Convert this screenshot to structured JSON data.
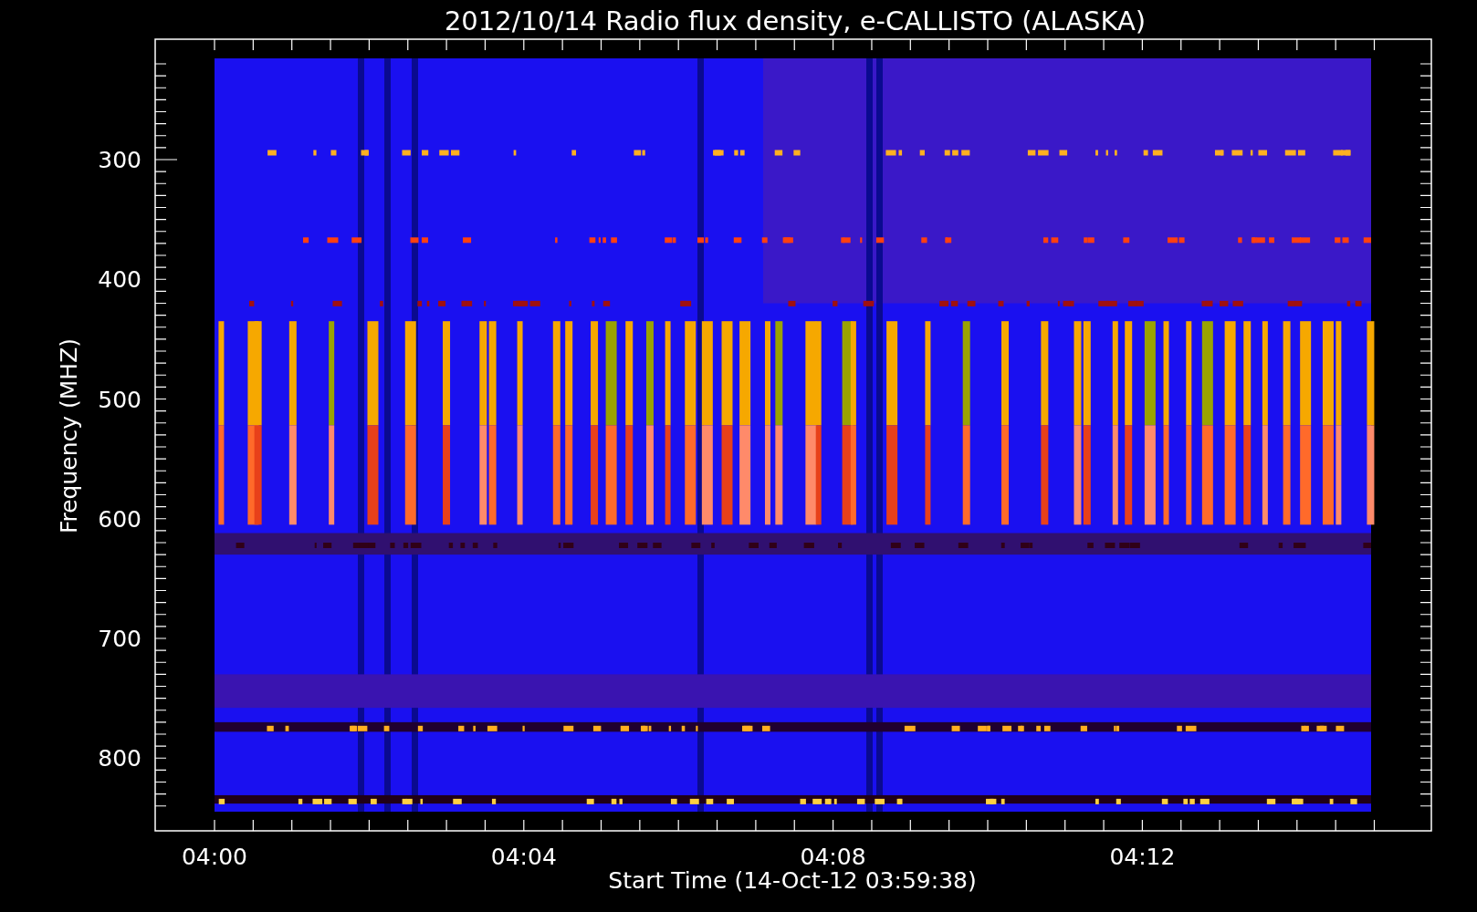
{
  "title": "2012/10/14  Radio flux density, e-CALLISTO (ALASKA)",
  "y_axis": {
    "label": "Frequency (MHZ)",
    "ticks": [
      "300",
      "400",
      "500",
      "600",
      "700",
      "800"
    ]
  },
  "x_axis": {
    "label": "Start Time (14-Oct-12 03:59:38)",
    "ticks": [
      "04:00",
      "04:04",
      "04:08",
      "04:12"
    ]
  }
}
